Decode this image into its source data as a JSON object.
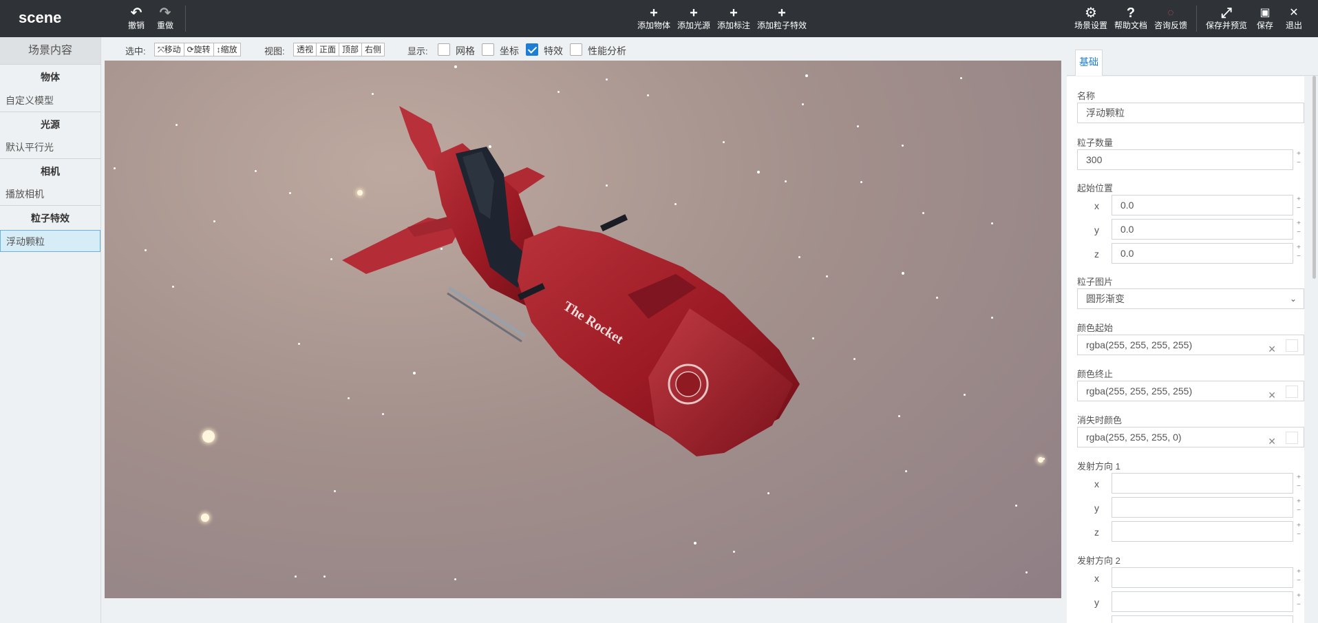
{
  "app": {
    "title": "scene"
  },
  "toolbar_left": [
    {
      "icon": "undo-icon",
      "glyph": "↶",
      "label": "撤销"
    },
    {
      "icon": "redo-icon",
      "glyph": "↷",
      "label": "重做"
    }
  ],
  "toolbar_center": [
    {
      "icon": "plus-icon",
      "glyph": "+",
      "label": "添加物体"
    },
    {
      "icon": "plus-icon",
      "glyph": "+",
      "label": "添加光源"
    },
    {
      "icon": "plus-icon",
      "glyph": "+",
      "label": "添加标注"
    },
    {
      "icon": "plus-icon",
      "glyph": "+",
      "label": "添加粒子特效"
    }
  ],
  "toolbar_right": [
    {
      "icon": "gear-icon",
      "glyph": "⚙",
      "label": "场景设置"
    },
    {
      "icon": "help-icon",
      "glyph": "?",
      "label": "帮助文档"
    },
    {
      "icon": "chat-icon",
      "glyph": "💬",
      "label": "咨询反馈"
    },
    {
      "icon": "expand-icon",
      "glyph": "⤢",
      "label": "保存并预览"
    },
    {
      "icon": "save-icon",
      "glyph": "▣",
      "label": "保存"
    },
    {
      "icon": "close-icon",
      "glyph": "✕",
      "label": "退出"
    }
  ],
  "left_panel": {
    "header": "场景内容",
    "groups": [
      {
        "title": "物体",
        "items": [
          "自定义模型"
        ]
      },
      {
        "title": "光源",
        "items": [
          "默认平行光"
        ]
      },
      {
        "title": "相机",
        "items": [
          "播放相机"
        ]
      },
      {
        "title": "粒子特效",
        "items": [
          "浮动颗粒"
        ]
      }
    ],
    "selected": "浮动颗粒"
  },
  "view_toolbar": {
    "select_label": "选中:",
    "select_modes": [
      "⤧移动",
      "⟳旋转",
      "↕缩放"
    ],
    "view_label": "视图:",
    "views": [
      "透视",
      "正面",
      "顶部",
      "右侧"
    ],
    "display_label": "显示:",
    "display_options": [
      {
        "label": "网格",
        "checked": false
      },
      {
        "label": "坐标",
        "checked": false
      },
      {
        "label": "特效",
        "checked": true
      },
      {
        "label": "性能分析",
        "checked": false
      }
    ]
  },
  "viewport": {
    "model_text": "The Rocket",
    "colors": {
      "body": "#a11d26",
      "seat": "#1f2530"
    }
  },
  "right_panel": {
    "tab": "基础",
    "name_label": "名称",
    "name_value": "浮动颗粒",
    "count_label": "粒子数量",
    "count_value": "300",
    "start_pos_label": "起始位置",
    "start_pos": {
      "x": "0.0",
      "y": "0.0",
      "z": "0.0"
    },
    "image_label": "粒子图片",
    "image_value": "圆形渐变",
    "color_start_label": "颜色起始",
    "color_start_value": "rgba(255, 255, 255, 255)",
    "color_end_label": "颜色终止",
    "color_end_value": "rgba(255, 255, 255, 255)",
    "fade_label": "消失时颜色",
    "fade_value": "rgba(255, 255, 255, 0)",
    "dir1_label": "发射方向 1",
    "dir2_label": "发射方向 2",
    "axis_x": "x",
    "axis_y": "y",
    "axis_z": "z"
  }
}
